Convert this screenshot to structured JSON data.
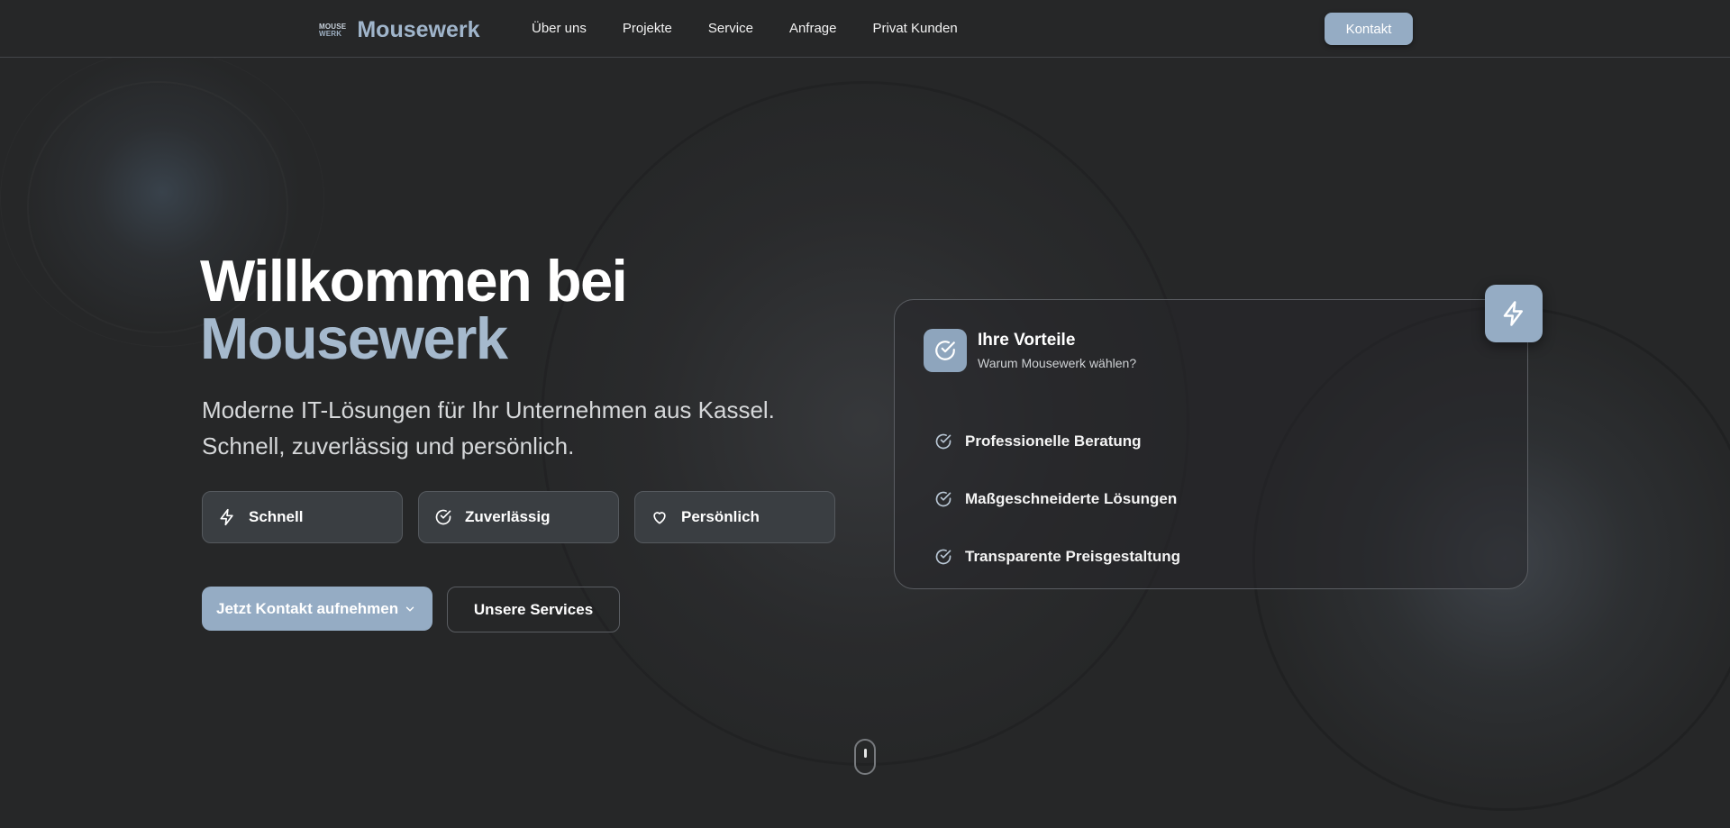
{
  "nav": {
    "logo_line1": "MOUSE",
    "logo_line2": "WERK",
    "brand_name": "Mousewerk",
    "links": [
      "Über uns",
      "Projekte",
      "Service",
      "Anfrage",
      "Privat Kunden"
    ],
    "contact_button": "Kontakt"
  },
  "hero": {
    "title_line1": "Willkommen bei",
    "title_line2": "Mousewerk",
    "subtitle_line1": "Moderne IT-Lösungen für Ihr Unternehmen aus Kassel.",
    "subtitle_line2": "Schnell, zuverlässig und persönlich.",
    "features": [
      {
        "label": "Schnell",
        "icon": "bolt-icon"
      },
      {
        "label": "Zuverlässig",
        "icon": "check-circle-icon"
      },
      {
        "label": "Persönlich",
        "icon": "heart-icon"
      }
    ],
    "cta_primary": "Jetzt Kontakt aufnehmen",
    "cta_secondary": "Unsere Services"
  },
  "card": {
    "title": "Ihre Vorteile",
    "subtitle": "Warum Mousewerk wählen?",
    "items": [
      "Professionelle Beratung",
      "Maßgeschneiderte Lösungen",
      "Transparente Preisgestaltung"
    ]
  },
  "colors": {
    "background": "#262728",
    "accent": "#95acc4",
    "accent_text": "#a5b9cd"
  }
}
